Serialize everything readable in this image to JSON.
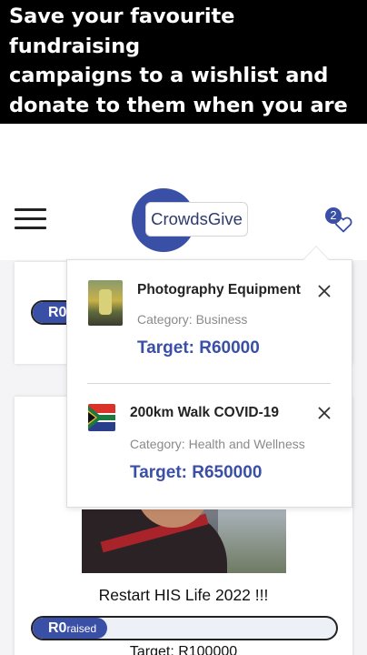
{
  "banner": {
    "text": "Save your favourite fundraising\ncampaigns to a wishlist and\ndonate to them when you are\nready"
  },
  "header": {
    "logo_text": "CrowdsGive",
    "wishlist_count": "2"
  },
  "cards": [
    {
      "raised_amount": "R0",
      "raised_label": "raised",
      "raised_fraction": 0
    },
    {
      "title": "Restart HIS Life 2022 !!!",
      "raised_amount": "R0",
      "raised_label": "raised",
      "raised_fraction": 0,
      "target": "Target: R100000"
    }
  ],
  "wishlist": {
    "items": [
      {
        "name": "Photography Equipment",
        "category": "Category: Business",
        "target": "Target: R60000"
      },
      {
        "name": "200km Walk COVID-19",
        "category": "Category: Health and Wellness",
        "target": "Target: R650000"
      }
    ]
  },
  "colors": {
    "brand": "#3a4fa6",
    "banner_bg": "#000000"
  }
}
